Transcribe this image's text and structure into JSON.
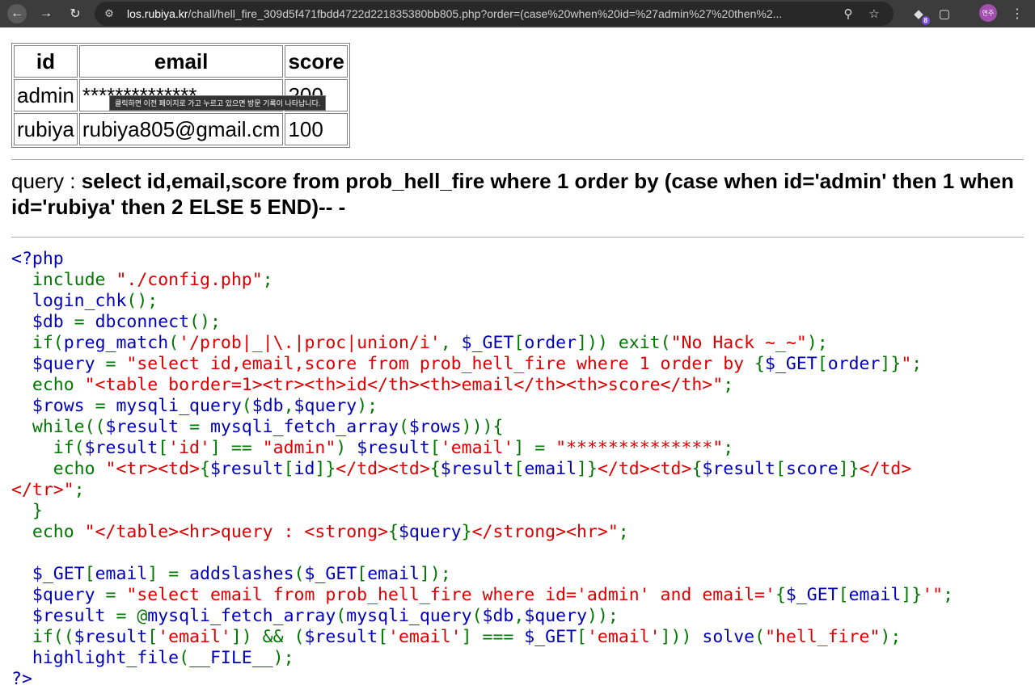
{
  "browser": {
    "url_host": "los.rubiya.kr",
    "url_rest": "/chall/hell_fire_309d5f471fbdd4722d221835380bb805.php?order=(case%20when%20id=%27admin%27%20then%2...",
    "ext_badge": "8",
    "avatar_text": "연주"
  },
  "table": {
    "headers": [
      "id",
      "email",
      "score"
    ],
    "rows": [
      [
        "admin",
        "**************",
        "200"
      ],
      [
        "rubiya",
        "rubiya805@gmail.cm",
        "100"
      ]
    ]
  },
  "tooltip": "클릭하면 이전 페이지로 가고 누르고 있으면 방문 기록이 나타납니다.",
  "query": {
    "label": "query : ",
    "sql": "select id,email,score from prob_hell_fire where 1 order by (case when id='admin' then 1 when id='rubiya' then 2 ELSE 5 END)-- -"
  },
  "source_code": [
    [
      [
        "v",
        "<?php"
      ]
    ],
    [
      [
        "k",
        "  include "
      ],
      [
        "s",
        "\"./config.php\""
      ],
      [
        "k",
        ";"
      ]
    ],
    [
      [
        "k",
        "  "
      ],
      [
        "v",
        "login_chk"
      ],
      [
        "k",
        "();"
      ]
    ],
    [
      [
        "k",
        "  "
      ],
      [
        "v",
        "$db "
      ],
      [
        "k",
        "= "
      ],
      [
        "v",
        "dbconnect"
      ],
      [
        "k",
        "();"
      ]
    ],
    [
      [
        "k",
        "  if("
      ],
      [
        "v",
        "preg_match"
      ],
      [
        "k",
        "("
      ],
      [
        "s",
        "'/prob|_|\\.|proc|union/i'"
      ],
      [
        "k",
        ", "
      ],
      [
        "v",
        "$_GET"
      ],
      [
        "k",
        "["
      ],
      [
        "v",
        "order"
      ],
      [
        "k",
        "])) exit("
      ],
      [
        "s",
        "\"No Hack ~_~\""
      ],
      [
        "k",
        ");"
      ]
    ],
    [
      [
        "k",
        "  "
      ],
      [
        "v",
        "$query "
      ],
      [
        "k",
        "= "
      ],
      [
        "s",
        "\"select id,email,score from prob_hell_fire where 1 order by "
      ],
      [
        "k",
        "{"
      ],
      [
        "v",
        "$_GET"
      ],
      [
        "k",
        "["
      ],
      [
        "v",
        "order"
      ],
      [
        "k",
        "]}"
      ],
      [
        "s",
        "\""
      ],
      [
        "k",
        ";"
      ]
    ],
    [
      [
        "k",
        "  echo "
      ],
      [
        "s",
        "\"<table border=1><tr><th>id</th><th>email</th><th>score</th>\""
      ],
      [
        "k",
        ";"
      ]
    ],
    [
      [
        "k",
        "  "
      ],
      [
        "v",
        "$rows "
      ],
      [
        "k",
        "= "
      ],
      [
        "v",
        "mysqli_query"
      ],
      [
        "k",
        "("
      ],
      [
        "v",
        "$db"
      ],
      [
        "k",
        ","
      ],
      [
        "v",
        "$query"
      ],
      [
        "k",
        ");"
      ]
    ],
    [
      [
        "k",
        "  while(("
      ],
      [
        "v",
        "$result "
      ],
      [
        "k",
        "= "
      ],
      [
        "v",
        "mysqli_fetch_array"
      ],
      [
        "k",
        "("
      ],
      [
        "v",
        "$rows"
      ],
      [
        "k",
        "))){"
      ]
    ],
    [
      [
        "k",
        "    if("
      ],
      [
        "v",
        "$result"
      ],
      [
        "k",
        "["
      ],
      [
        "s",
        "'id'"
      ],
      [
        "k",
        "] == "
      ],
      [
        "s",
        "\"admin\""
      ],
      [
        "k",
        ") "
      ],
      [
        "v",
        "$result"
      ],
      [
        "k",
        "["
      ],
      [
        "s",
        "'email'"
      ],
      [
        "k",
        "] = "
      ],
      [
        "s",
        "\"**************\""
      ],
      [
        "k",
        ";"
      ]
    ],
    [
      [
        "k",
        "    echo "
      ],
      [
        "s",
        "\"<tr><td>"
      ],
      [
        "k",
        "{"
      ],
      [
        "v",
        "$result"
      ],
      [
        "k",
        "["
      ],
      [
        "v",
        "id"
      ],
      [
        "k",
        "]}"
      ],
      [
        "s",
        "</td><td>"
      ],
      [
        "k",
        "{"
      ],
      [
        "v",
        "$result"
      ],
      [
        "k",
        "["
      ],
      [
        "v",
        "email"
      ],
      [
        "k",
        "]}"
      ],
      [
        "s",
        "</td><td>"
      ],
      [
        "k",
        "{"
      ],
      [
        "v",
        "$result"
      ],
      [
        "k",
        "["
      ],
      [
        "v",
        "score"
      ],
      [
        "k",
        "]}"
      ],
      [
        "s",
        "</td>"
      ]
    ],
    [
      [
        "s",
        "</tr>\""
      ],
      [
        "k",
        ";"
      ]
    ],
    [
      [
        "k",
        "  }"
      ]
    ],
    [
      [
        "k",
        "  echo "
      ],
      [
        "s",
        "\"</table><hr>query : <strong>"
      ],
      [
        "k",
        "{"
      ],
      [
        "v",
        "$query"
      ],
      [
        "k",
        "}"
      ],
      [
        "s",
        "</strong><hr>\""
      ],
      [
        "k",
        ";"
      ]
    ],
    [
      [
        "k",
        ""
      ]
    ],
    [
      [
        "k",
        "  "
      ],
      [
        "v",
        "$_GET"
      ],
      [
        "k",
        "["
      ],
      [
        "v",
        "email"
      ],
      [
        "k",
        "] = "
      ],
      [
        "v",
        "addslashes"
      ],
      [
        "k",
        "("
      ],
      [
        "v",
        "$_GET"
      ],
      [
        "k",
        "["
      ],
      [
        "v",
        "email"
      ],
      [
        "k",
        "]);"
      ]
    ],
    [
      [
        "k",
        "  "
      ],
      [
        "v",
        "$query "
      ],
      [
        "k",
        "= "
      ],
      [
        "s",
        "\"select email from prob_hell_fire where id='admin' and email='"
      ],
      [
        "k",
        "{"
      ],
      [
        "v",
        "$_GET"
      ],
      [
        "k",
        "["
      ],
      [
        "v",
        "email"
      ],
      [
        "k",
        "]}"
      ],
      [
        "s",
        "'\""
      ],
      [
        "k",
        ";"
      ]
    ],
    [
      [
        "k",
        "  "
      ],
      [
        "v",
        "$result "
      ],
      [
        "k",
        "= @"
      ],
      [
        "v",
        "mysqli_fetch_array"
      ],
      [
        "k",
        "("
      ],
      [
        "v",
        "mysqli_query"
      ],
      [
        "k",
        "("
      ],
      [
        "v",
        "$db"
      ],
      [
        "k",
        ","
      ],
      [
        "v",
        "$query"
      ],
      [
        "k",
        "));"
      ]
    ],
    [
      [
        "k",
        "  if(("
      ],
      [
        "v",
        "$result"
      ],
      [
        "k",
        "["
      ],
      [
        "s",
        "'email'"
      ],
      [
        "k",
        "]) && ("
      ],
      [
        "v",
        "$result"
      ],
      [
        "k",
        "["
      ],
      [
        "s",
        "'email'"
      ],
      [
        "k",
        "] === "
      ],
      [
        "v",
        "$_GET"
      ],
      [
        "k",
        "["
      ],
      [
        "s",
        "'email'"
      ],
      [
        "k",
        "])) "
      ],
      [
        "v",
        "solve"
      ],
      [
        "k",
        "("
      ],
      [
        "s",
        "\"hell_fire\""
      ],
      [
        "k",
        ");"
      ]
    ],
    [
      [
        "k",
        "  "
      ],
      [
        "v",
        "highlight_file"
      ],
      [
        "k",
        "("
      ],
      [
        "v",
        "__FILE__"
      ],
      [
        "k",
        ");"
      ]
    ],
    [
      [
        "v",
        "?>"
      ]
    ]
  ],
  "icons": {
    "back": "arrow-left-icon",
    "forward": "arrow-right-icon",
    "reload": "reload-icon",
    "site_info": "site-settings-icon",
    "zoom": "zoom-icon",
    "bookmark": "star-icon",
    "extension": "extension-icon",
    "extensions_menu": "puzzle-icon",
    "menu": "kebab-menu-icon"
  }
}
